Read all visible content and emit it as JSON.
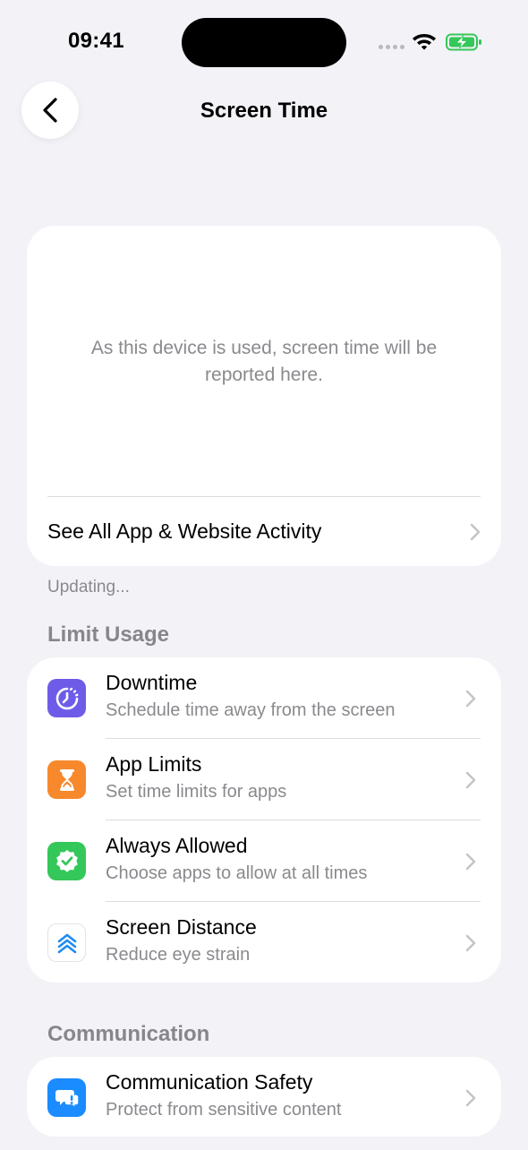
{
  "status": {
    "time": "09:41"
  },
  "nav": {
    "title": "Screen Time"
  },
  "report": {
    "message": "As this device is used, screen time will be reported here.",
    "link_label": "See All App & Website Activity"
  },
  "footnote": "Updating...",
  "limit_usage": {
    "header": "Limit Usage",
    "items": [
      {
        "title": "Downtime",
        "subtitle": "Schedule time away from the screen",
        "icon": "downtime-icon",
        "color": "#6e5ce8"
      },
      {
        "title": "App Limits",
        "subtitle": "Set time limits for apps",
        "icon": "hourglass-icon",
        "color": "#f7892c"
      },
      {
        "title": "Always Allowed",
        "subtitle": "Choose apps to allow at all times",
        "icon": "checkmark-seal-icon",
        "color": "#34c759"
      },
      {
        "title": "Screen Distance",
        "subtitle": "Reduce eye strain",
        "icon": "screen-distance-icon",
        "color": "#ffffff"
      }
    ]
  },
  "communication": {
    "header": "Communication",
    "items": [
      {
        "title": "Communication Safety",
        "subtitle": "Protect from sensitive content",
        "icon": "communication-safety-icon",
        "color": "#1a8cff"
      }
    ]
  }
}
